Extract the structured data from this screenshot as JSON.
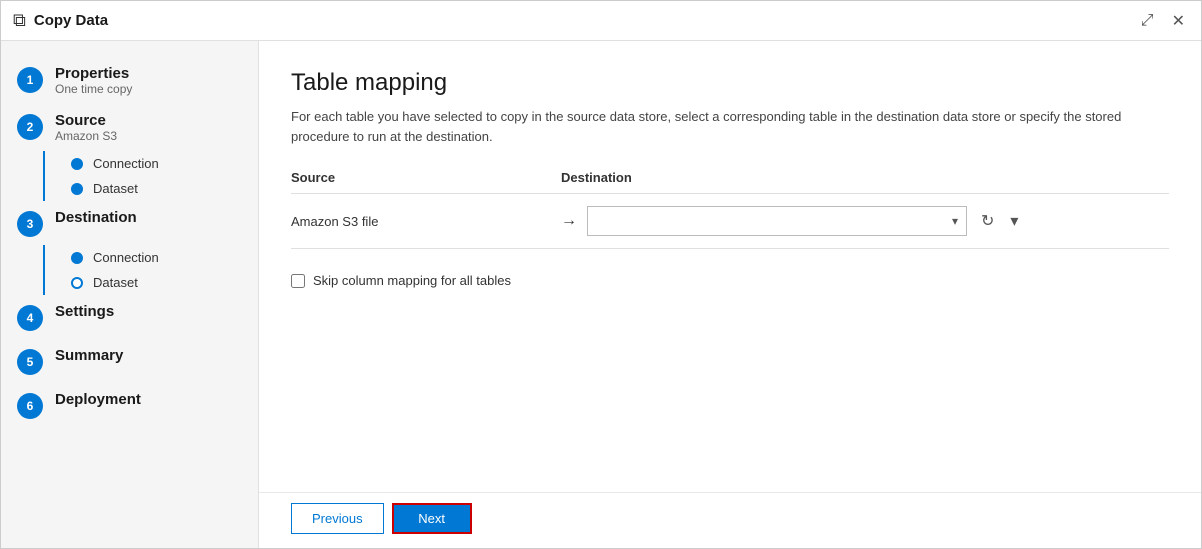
{
  "titleBar": {
    "icon": "🔁",
    "title": "Copy Data",
    "expandLabel": "⤢",
    "closeLabel": "✕"
  },
  "sidebar": {
    "steps": [
      {
        "id": 1,
        "name": "Properties",
        "sub": "One time copy",
        "circleType": "filled",
        "subItems": []
      },
      {
        "id": 2,
        "name": "Source",
        "sub": "Amazon S3",
        "circleType": "filled",
        "subItems": [
          {
            "label": "Connection",
            "type": "filled"
          },
          {
            "label": "Dataset",
            "type": "filled"
          }
        ]
      },
      {
        "id": 3,
        "name": "Destination",
        "sub": "",
        "circleType": "filled",
        "subItems": [
          {
            "label": "Connection",
            "type": "filled"
          },
          {
            "label": "Dataset",
            "type": "outline"
          }
        ]
      },
      {
        "id": 4,
        "name": "Settings",
        "sub": "",
        "circleType": "filled",
        "subItems": []
      },
      {
        "id": 5,
        "name": "Summary",
        "sub": "",
        "circleType": "filled",
        "subItems": []
      },
      {
        "id": 6,
        "name": "Deployment",
        "sub": "",
        "circleType": "filled",
        "subItems": []
      }
    ]
  },
  "content": {
    "title": "Table mapping",
    "description": "For each table you have selected to copy in the source data store, select a corresponding table in the destination data store or specify the stored procedure to run at the destination.",
    "tableHeader": {
      "source": "Source",
      "destination": "Destination"
    },
    "mappingRow": {
      "sourceLabel": "Amazon S3 file",
      "destPlaceholder": "",
      "arrowSymbol": "→"
    },
    "checkboxLabel": "Skip column mapping for all tables",
    "buttons": {
      "previous": "Previous",
      "next": "Next"
    }
  }
}
